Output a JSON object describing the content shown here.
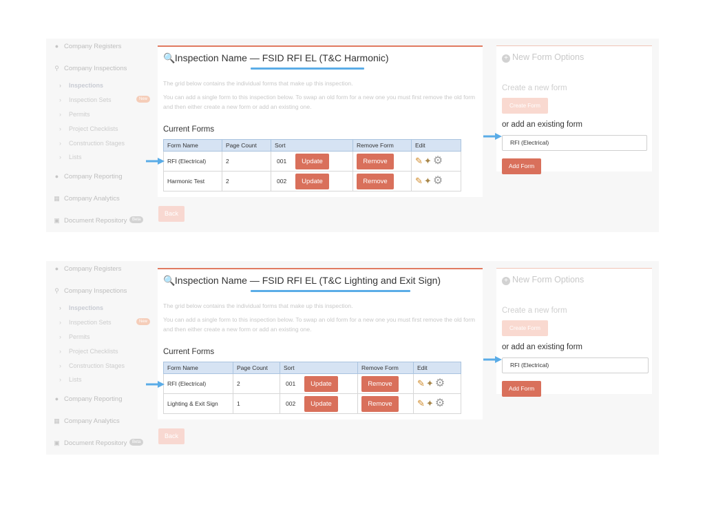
{
  "panels": [
    {
      "sidebar": {
        "items": [
          {
            "label": "Company Registers",
            "icon": "users-icon"
          },
          {
            "label": "Company Inspections",
            "icon": "search-icon"
          },
          {
            "label": "Company Reporting",
            "icon": "globe-icon"
          },
          {
            "label": "Company Analytics",
            "icon": "bar-chart-icon"
          },
          {
            "label": "Document Repository",
            "icon": "files-icon",
            "badge": "Beta"
          }
        ],
        "subitems": [
          {
            "label": "Inspections",
            "active": true
          },
          {
            "label": "Inspection Sets",
            "badge": "New"
          },
          {
            "label": "Permits"
          },
          {
            "label": "Project Checklists"
          },
          {
            "label": "Construction Stages"
          },
          {
            "label": "Lists"
          }
        ]
      },
      "main": {
        "title_prefix": "Inspection Name — ",
        "title_name": "FSID RFI EL (T&C Harmonic)",
        "desc1": "The grid below contains the individual forms that make up this inspection.",
        "desc2": "You can add a single form to this inspection below. To swap an old form for a new one you must first remove the old form and then either create a new form or add an existing one.",
        "current_forms": "Current Forms",
        "columns": [
          "Form Name",
          "Page Count",
          "Sort",
          "Remove Form",
          "Edit"
        ],
        "rows": [
          {
            "name": "RFI (Electrical)",
            "pages": "2",
            "sort": "001",
            "update": "Update",
            "remove": "Remove"
          },
          {
            "name": "Harmonic Test",
            "pages": "2",
            "sort": "002",
            "update": "Update",
            "remove": "Remove"
          }
        ],
        "back": "Back"
      },
      "options": {
        "title": "New Form Options",
        "create_label": "Create a new form",
        "create_btn": "Create Form",
        "existing_label": "or add an existing form",
        "existing_value": "RFI (Electrical)",
        "add_btn": "Add Form"
      }
    },
    {
      "sidebar": {
        "items": [
          {
            "label": "Company Registers",
            "icon": "users-icon"
          },
          {
            "label": "Company Inspections",
            "icon": "search-icon"
          },
          {
            "label": "Company Reporting",
            "icon": "globe-icon"
          },
          {
            "label": "Company Analytics",
            "icon": "bar-chart-icon"
          },
          {
            "label": "Document Repository",
            "icon": "files-icon",
            "badge": "Beta"
          }
        ],
        "subitems": [
          {
            "label": "Inspections",
            "active": true
          },
          {
            "label": "Inspection Sets",
            "badge": "New"
          },
          {
            "label": "Permits"
          },
          {
            "label": "Project Checklists"
          },
          {
            "label": "Construction Stages"
          },
          {
            "label": "Lists"
          }
        ]
      },
      "main": {
        "title_prefix": "Inspection Name — ",
        "title_name": "FSID RFI EL (T&C Lighting and Exit Sign)",
        "desc1": "The grid below contains the individual forms that make up this inspection.",
        "desc2": "You can add a single form to this inspection below. To swap an old form for a new one you must first remove the old form and then either create a new form or add an existing one.",
        "current_forms": "Current Forms",
        "columns": [
          "Form Name",
          "Page Count",
          "Sort",
          "Remove Form",
          "Edit"
        ],
        "rows": [
          {
            "name": "RFI (Electrical)",
            "pages": "2",
            "sort": "001",
            "update": "Update",
            "remove": "Remove"
          },
          {
            "name": "Lighting & Exit Sign",
            "pages": "1",
            "sort": "002",
            "update": "Update",
            "remove": "Remove"
          }
        ],
        "back": "Back"
      },
      "options": {
        "title": "New Form Options",
        "create_label": "Create a new form",
        "create_btn": "Create Form",
        "existing_label": "or add an existing form",
        "existing_value": "RFI (Electrical)",
        "add_btn": "Add Form"
      }
    }
  ],
  "colors": {
    "accent": "#d9705b",
    "highlight_blue": "#5aace7",
    "table_header": "#d6e3f3"
  }
}
